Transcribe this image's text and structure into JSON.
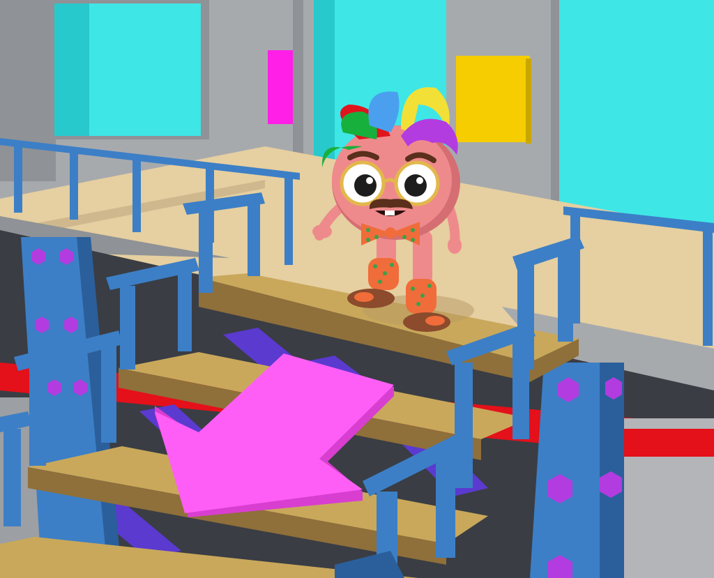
{
  "scene": {
    "description_free": true,
    "colors": {
      "wall": "#a7aaad",
      "wall_shadow": "#8f9296",
      "window_cyan": "#3fe6e6",
      "window_cyan_dark": "#28c9cc",
      "floor": "#e6cfa0",
      "floor_edge": "#b7a27a",
      "rail_blue": "#3c7fc6",
      "rail_blue_dark": "#2b5f9b",
      "stair_top": "#c9a85b",
      "stair_side": "#8f6f3a",
      "bolt_purple": "#b23ce0",
      "arrow_pink": "#ff5ef6",
      "arrow_pink_dark": "#d83fd0",
      "sign_magenta": "#ff1fe6",
      "sign_yellow": "#f5cd00",
      "stripe_red": "#e4101a",
      "beam_purple": "#5b3ad0",
      "character_skin": "#ef8a8c",
      "character_skin_dark": "#d56e72",
      "sandal_brown": "#8b4b2c",
      "sock_orange": "#f06c3a",
      "glasses_gold": "#e2b84b"
    },
    "icons": {
      "direction_arrow": "arrow-down-left-icon",
      "character": "character-avatar"
    }
  }
}
